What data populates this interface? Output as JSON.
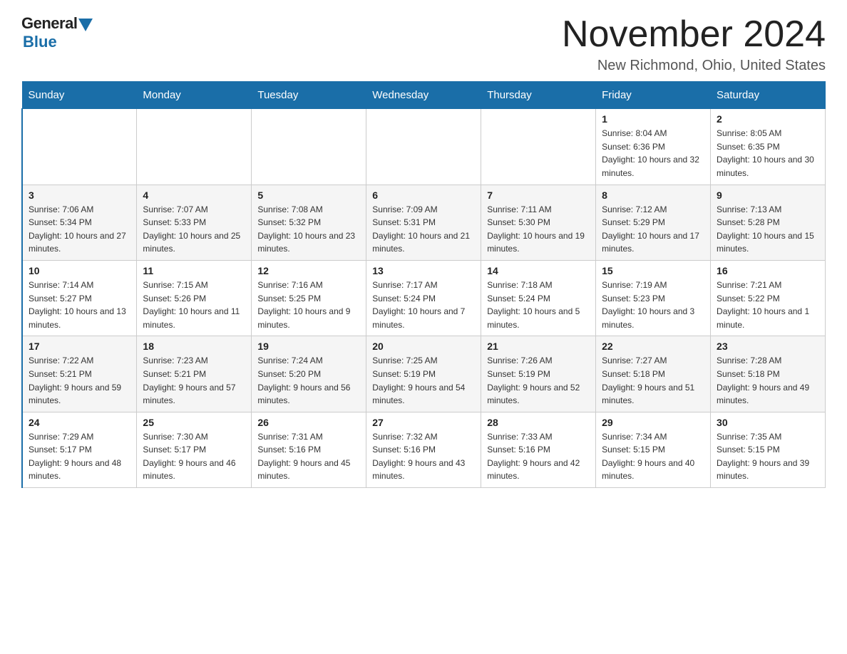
{
  "logo": {
    "general": "General",
    "blue": "Blue"
  },
  "title": "November 2024",
  "subtitle": "New Richmond, Ohio, United States",
  "weekdays": [
    "Sunday",
    "Monday",
    "Tuesday",
    "Wednesday",
    "Thursday",
    "Friday",
    "Saturday"
  ],
  "rows": [
    [
      {
        "day": "",
        "sunrise": "",
        "sunset": "",
        "daylight": ""
      },
      {
        "day": "",
        "sunrise": "",
        "sunset": "",
        "daylight": ""
      },
      {
        "day": "",
        "sunrise": "",
        "sunset": "",
        "daylight": ""
      },
      {
        "day": "",
        "sunrise": "",
        "sunset": "",
        "daylight": ""
      },
      {
        "day": "",
        "sunrise": "",
        "sunset": "",
        "daylight": ""
      },
      {
        "day": "1",
        "sunrise": "Sunrise: 8:04 AM",
        "sunset": "Sunset: 6:36 PM",
        "daylight": "Daylight: 10 hours and 32 minutes."
      },
      {
        "day": "2",
        "sunrise": "Sunrise: 8:05 AM",
        "sunset": "Sunset: 6:35 PM",
        "daylight": "Daylight: 10 hours and 30 minutes."
      }
    ],
    [
      {
        "day": "3",
        "sunrise": "Sunrise: 7:06 AM",
        "sunset": "Sunset: 5:34 PM",
        "daylight": "Daylight: 10 hours and 27 minutes."
      },
      {
        "day": "4",
        "sunrise": "Sunrise: 7:07 AM",
        "sunset": "Sunset: 5:33 PM",
        "daylight": "Daylight: 10 hours and 25 minutes."
      },
      {
        "day": "5",
        "sunrise": "Sunrise: 7:08 AM",
        "sunset": "Sunset: 5:32 PM",
        "daylight": "Daylight: 10 hours and 23 minutes."
      },
      {
        "day": "6",
        "sunrise": "Sunrise: 7:09 AM",
        "sunset": "Sunset: 5:31 PM",
        "daylight": "Daylight: 10 hours and 21 minutes."
      },
      {
        "day": "7",
        "sunrise": "Sunrise: 7:11 AM",
        "sunset": "Sunset: 5:30 PM",
        "daylight": "Daylight: 10 hours and 19 minutes."
      },
      {
        "day": "8",
        "sunrise": "Sunrise: 7:12 AM",
        "sunset": "Sunset: 5:29 PM",
        "daylight": "Daylight: 10 hours and 17 minutes."
      },
      {
        "day": "9",
        "sunrise": "Sunrise: 7:13 AM",
        "sunset": "Sunset: 5:28 PM",
        "daylight": "Daylight: 10 hours and 15 minutes."
      }
    ],
    [
      {
        "day": "10",
        "sunrise": "Sunrise: 7:14 AM",
        "sunset": "Sunset: 5:27 PM",
        "daylight": "Daylight: 10 hours and 13 minutes."
      },
      {
        "day": "11",
        "sunrise": "Sunrise: 7:15 AM",
        "sunset": "Sunset: 5:26 PM",
        "daylight": "Daylight: 10 hours and 11 minutes."
      },
      {
        "day": "12",
        "sunrise": "Sunrise: 7:16 AM",
        "sunset": "Sunset: 5:25 PM",
        "daylight": "Daylight: 10 hours and 9 minutes."
      },
      {
        "day": "13",
        "sunrise": "Sunrise: 7:17 AM",
        "sunset": "Sunset: 5:24 PM",
        "daylight": "Daylight: 10 hours and 7 minutes."
      },
      {
        "day": "14",
        "sunrise": "Sunrise: 7:18 AM",
        "sunset": "Sunset: 5:24 PM",
        "daylight": "Daylight: 10 hours and 5 minutes."
      },
      {
        "day": "15",
        "sunrise": "Sunrise: 7:19 AM",
        "sunset": "Sunset: 5:23 PM",
        "daylight": "Daylight: 10 hours and 3 minutes."
      },
      {
        "day": "16",
        "sunrise": "Sunrise: 7:21 AM",
        "sunset": "Sunset: 5:22 PM",
        "daylight": "Daylight: 10 hours and 1 minute."
      }
    ],
    [
      {
        "day": "17",
        "sunrise": "Sunrise: 7:22 AM",
        "sunset": "Sunset: 5:21 PM",
        "daylight": "Daylight: 9 hours and 59 minutes."
      },
      {
        "day": "18",
        "sunrise": "Sunrise: 7:23 AM",
        "sunset": "Sunset: 5:21 PM",
        "daylight": "Daylight: 9 hours and 57 minutes."
      },
      {
        "day": "19",
        "sunrise": "Sunrise: 7:24 AM",
        "sunset": "Sunset: 5:20 PM",
        "daylight": "Daylight: 9 hours and 56 minutes."
      },
      {
        "day": "20",
        "sunrise": "Sunrise: 7:25 AM",
        "sunset": "Sunset: 5:19 PM",
        "daylight": "Daylight: 9 hours and 54 minutes."
      },
      {
        "day": "21",
        "sunrise": "Sunrise: 7:26 AM",
        "sunset": "Sunset: 5:19 PM",
        "daylight": "Daylight: 9 hours and 52 minutes."
      },
      {
        "day": "22",
        "sunrise": "Sunrise: 7:27 AM",
        "sunset": "Sunset: 5:18 PM",
        "daylight": "Daylight: 9 hours and 51 minutes."
      },
      {
        "day": "23",
        "sunrise": "Sunrise: 7:28 AM",
        "sunset": "Sunset: 5:18 PM",
        "daylight": "Daylight: 9 hours and 49 minutes."
      }
    ],
    [
      {
        "day": "24",
        "sunrise": "Sunrise: 7:29 AM",
        "sunset": "Sunset: 5:17 PM",
        "daylight": "Daylight: 9 hours and 48 minutes."
      },
      {
        "day": "25",
        "sunrise": "Sunrise: 7:30 AM",
        "sunset": "Sunset: 5:17 PM",
        "daylight": "Daylight: 9 hours and 46 minutes."
      },
      {
        "day": "26",
        "sunrise": "Sunrise: 7:31 AM",
        "sunset": "Sunset: 5:16 PM",
        "daylight": "Daylight: 9 hours and 45 minutes."
      },
      {
        "day": "27",
        "sunrise": "Sunrise: 7:32 AM",
        "sunset": "Sunset: 5:16 PM",
        "daylight": "Daylight: 9 hours and 43 minutes."
      },
      {
        "day": "28",
        "sunrise": "Sunrise: 7:33 AM",
        "sunset": "Sunset: 5:16 PM",
        "daylight": "Daylight: 9 hours and 42 minutes."
      },
      {
        "day": "29",
        "sunrise": "Sunrise: 7:34 AM",
        "sunset": "Sunset: 5:15 PM",
        "daylight": "Daylight: 9 hours and 40 minutes."
      },
      {
        "day": "30",
        "sunrise": "Sunrise: 7:35 AM",
        "sunset": "Sunset: 5:15 PM",
        "daylight": "Daylight: 9 hours and 39 minutes."
      }
    ]
  ]
}
